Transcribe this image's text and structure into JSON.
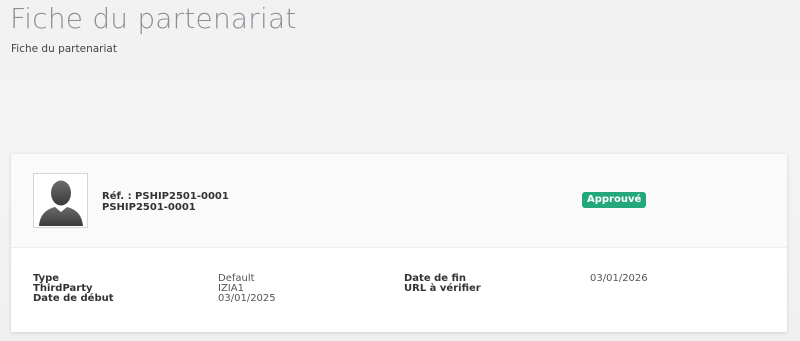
{
  "page": {
    "title": "Fiche du partenariat",
    "subtitle": "Fiche du partenariat"
  },
  "card": {
    "avatar_icon": "user-silhouette-icon",
    "ref_label": "Réf. : PSHIP2501-0001",
    "ref_sub": "PSHIP2501-0001",
    "status": {
      "label": "Approuvé",
      "color": "#24a77b"
    }
  },
  "fields": {
    "type": {
      "label": "Type",
      "value": "Default"
    },
    "thirdparty": {
      "label": "ThirdParty",
      "value": "IZIA1"
    },
    "date_debut": {
      "label": "Date de début",
      "value": "03/01/2025"
    },
    "date_fin": {
      "label": "Date de fin",
      "value": "03/01/2026"
    },
    "url_verifier": {
      "label": "URL à vérifier",
      "value": ""
    }
  }
}
